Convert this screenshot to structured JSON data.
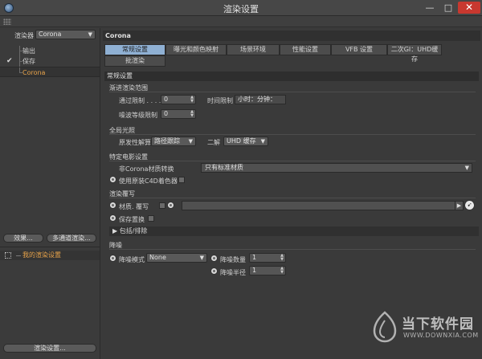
{
  "window": {
    "title": "渲染设置",
    "minimize": "—",
    "maximize": "□",
    "close": "✕"
  },
  "left": {
    "renderer_label": "渲染器",
    "renderer_value": "Corona",
    "tree": [
      {
        "label": "输出",
        "checked": false,
        "selected": false
      },
      {
        "label": "保存",
        "checked": true,
        "selected": false
      },
      {
        "label": "Corona",
        "checked": false,
        "selected": true
      }
    ],
    "effect_button": "效果...",
    "multipass_button": "多通道渲染...",
    "preset_item": "我的渲染设置",
    "render_settings_button": "渲染设置..."
  },
  "right": {
    "header": "Corona",
    "tabs": [
      "常规设置",
      "曝光和颜色映射",
      "场景环境",
      "性能设置",
      "VFB 设置",
      "二次GI：UHD缓存",
      "批渲染"
    ],
    "active_tab": 0,
    "section": "常规设置",
    "progressive": {
      "title": "渐进渲染范围",
      "pass_limit_label": "通过限制 . . . .",
      "pass_limit_value": "0",
      "time_limit_label": "时间限制",
      "time_limit_value": "小时：分钟：",
      "noise_limit_label": "噪波等级限制",
      "noise_limit_value": "0"
    },
    "gi": {
      "title": "全局光照",
      "primary_label": "原发性解算",
      "primary_value": "路径跟踪",
      "secondary_label": "二解",
      "secondary_value": "UHD 缓存"
    },
    "specific": {
      "title": "特定电影设置",
      "conversion_label": "非Corona材质转换",
      "conversion_value": "只有标准材质",
      "use_c4d_shaders": "使用原装C4D着色器"
    },
    "override": {
      "title": "渲染覆写",
      "material_override": "材质. 覆写",
      "keep_displacement": "保存置换",
      "include_exclude": "包括/排除"
    },
    "denoise": {
      "title": "降噪",
      "mode_label": "降噪模式",
      "mode_value": "None",
      "amount_label": "降噪数量",
      "amount_value": "1",
      "radius_label": "降噪半径",
      "radius_value": "1"
    }
  },
  "watermark": {
    "brand": "当下软件园",
    "url": "WWW.DOWNXIA.COM"
  },
  "colors": {
    "accent_active_tab": "#8fb0d3",
    "selected_text": "#e8a34a",
    "close_button": "#c8382f"
  }
}
